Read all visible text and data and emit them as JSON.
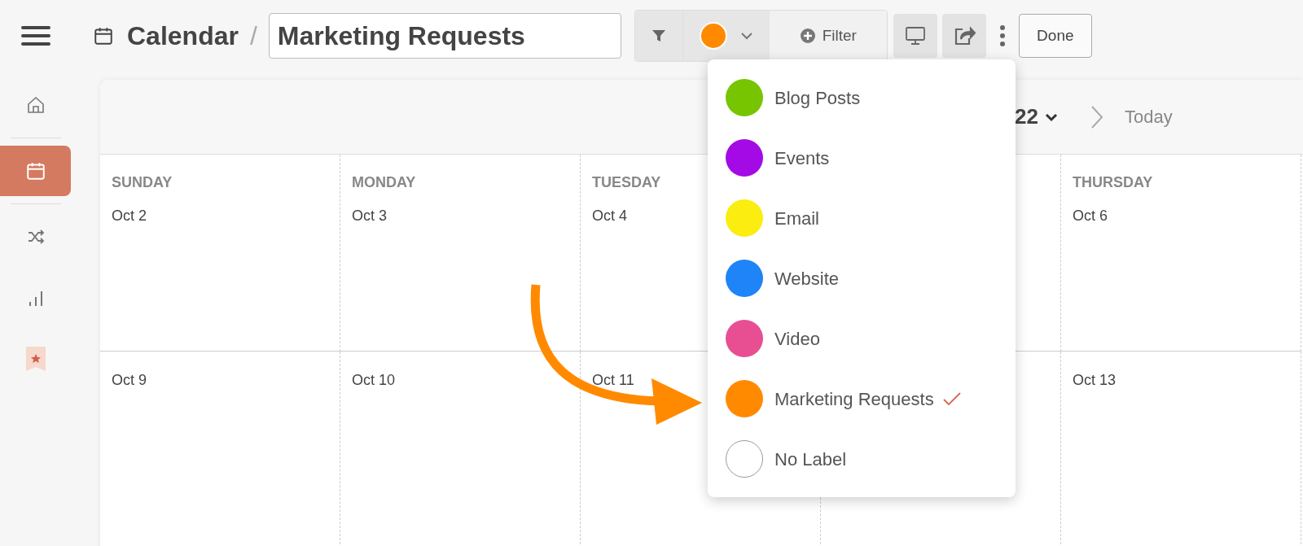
{
  "header": {
    "title": "Calendar",
    "separator": "/",
    "calendar_name": "Marketing Requests"
  },
  "toolbar": {
    "filter_button": "Filter",
    "done_button": "Done"
  },
  "sidebar": {
    "items": [
      {
        "kind": "home",
        "selected": false
      },
      {
        "kind": "calendar",
        "selected": true
      },
      {
        "kind": "shuffle",
        "selected": false
      },
      {
        "kind": "chart",
        "selected": false
      },
      {
        "kind": "star",
        "selected": false
      }
    ]
  },
  "calendar": {
    "period_fragment": "22",
    "today_button": "Today",
    "columns": [
      {
        "kind": "day",
        "weekday": "SUNDAY",
        "dates": [
          "Oct 2",
          "Oct 9"
        ]
      },
      {
        "kind": "day",
        "weekday": "MONDAY",
        "dates": [
          "Oct 3",
          "Oct 10"
        ]
      },
      {
        "kind": "day",
        "weekday": "TUESDAY",
        "dates": [
          "Oct 4",
          "Oct 11"
        ]
      },
      {
        "kind": "blank"
      },
      {
        "kind": "day",
        "weekday": "THURSDAY",
        "dates": [
          "Oct 6",
          "Oct 13"
        ]
      }
    ]
  },
  "label_menu": {
    "items": [
      {
        "label": "Blog Posts",
        "color": "#76c500",
        "selected": false
      },
      {
        "label": "Events",
        "color": "#a40ae6",
        "selected": false
      },
      {
        "label": "Email",
        "color": "#fbed10",
        "selected": false
      },
      {
        "label": "Website",
        "color": "#1e84f7",
        "selected": false
      },
      {
        "label": "Video",
        "color": "#e74f92",
        "selected": false
      },
      {
        "label": "Marketing Requests",
        "color": "#ff8a00",
        "selected": true
      },
      {
        "label": "No Label",
        "color": "#ffffff",
        "selected": false
      }
    ]
  }
}
